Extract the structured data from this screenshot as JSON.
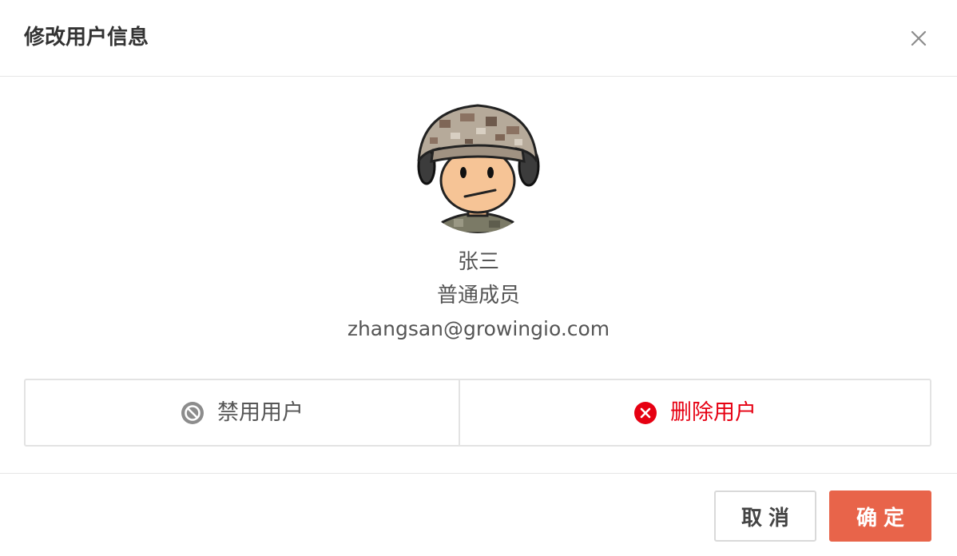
{
  "dialog": {
    "title": "修改用户信息",
    "close_icon": "close-icon"
  },
  "user": {
    "avatar_icon": "soldier-avatar",
    "name": "张三",
    "role": "普通成员",
    "email": "zhangsan@growingio.com"
  },
  "actions": {
    "disable": {
      "label": "禁用用户",
      "icon": "ban-icon",
      "color": "#555555"
    },
    "delete": {
      "label": "删除用户",
      "icon": "close-circle-icon",
      "color": "#e60012"
    }
  },
  "footer": {
    "cancel_label": "取消",
    "ok_label": "确定",
    "ok_color": "#e8644a"
  }
}
